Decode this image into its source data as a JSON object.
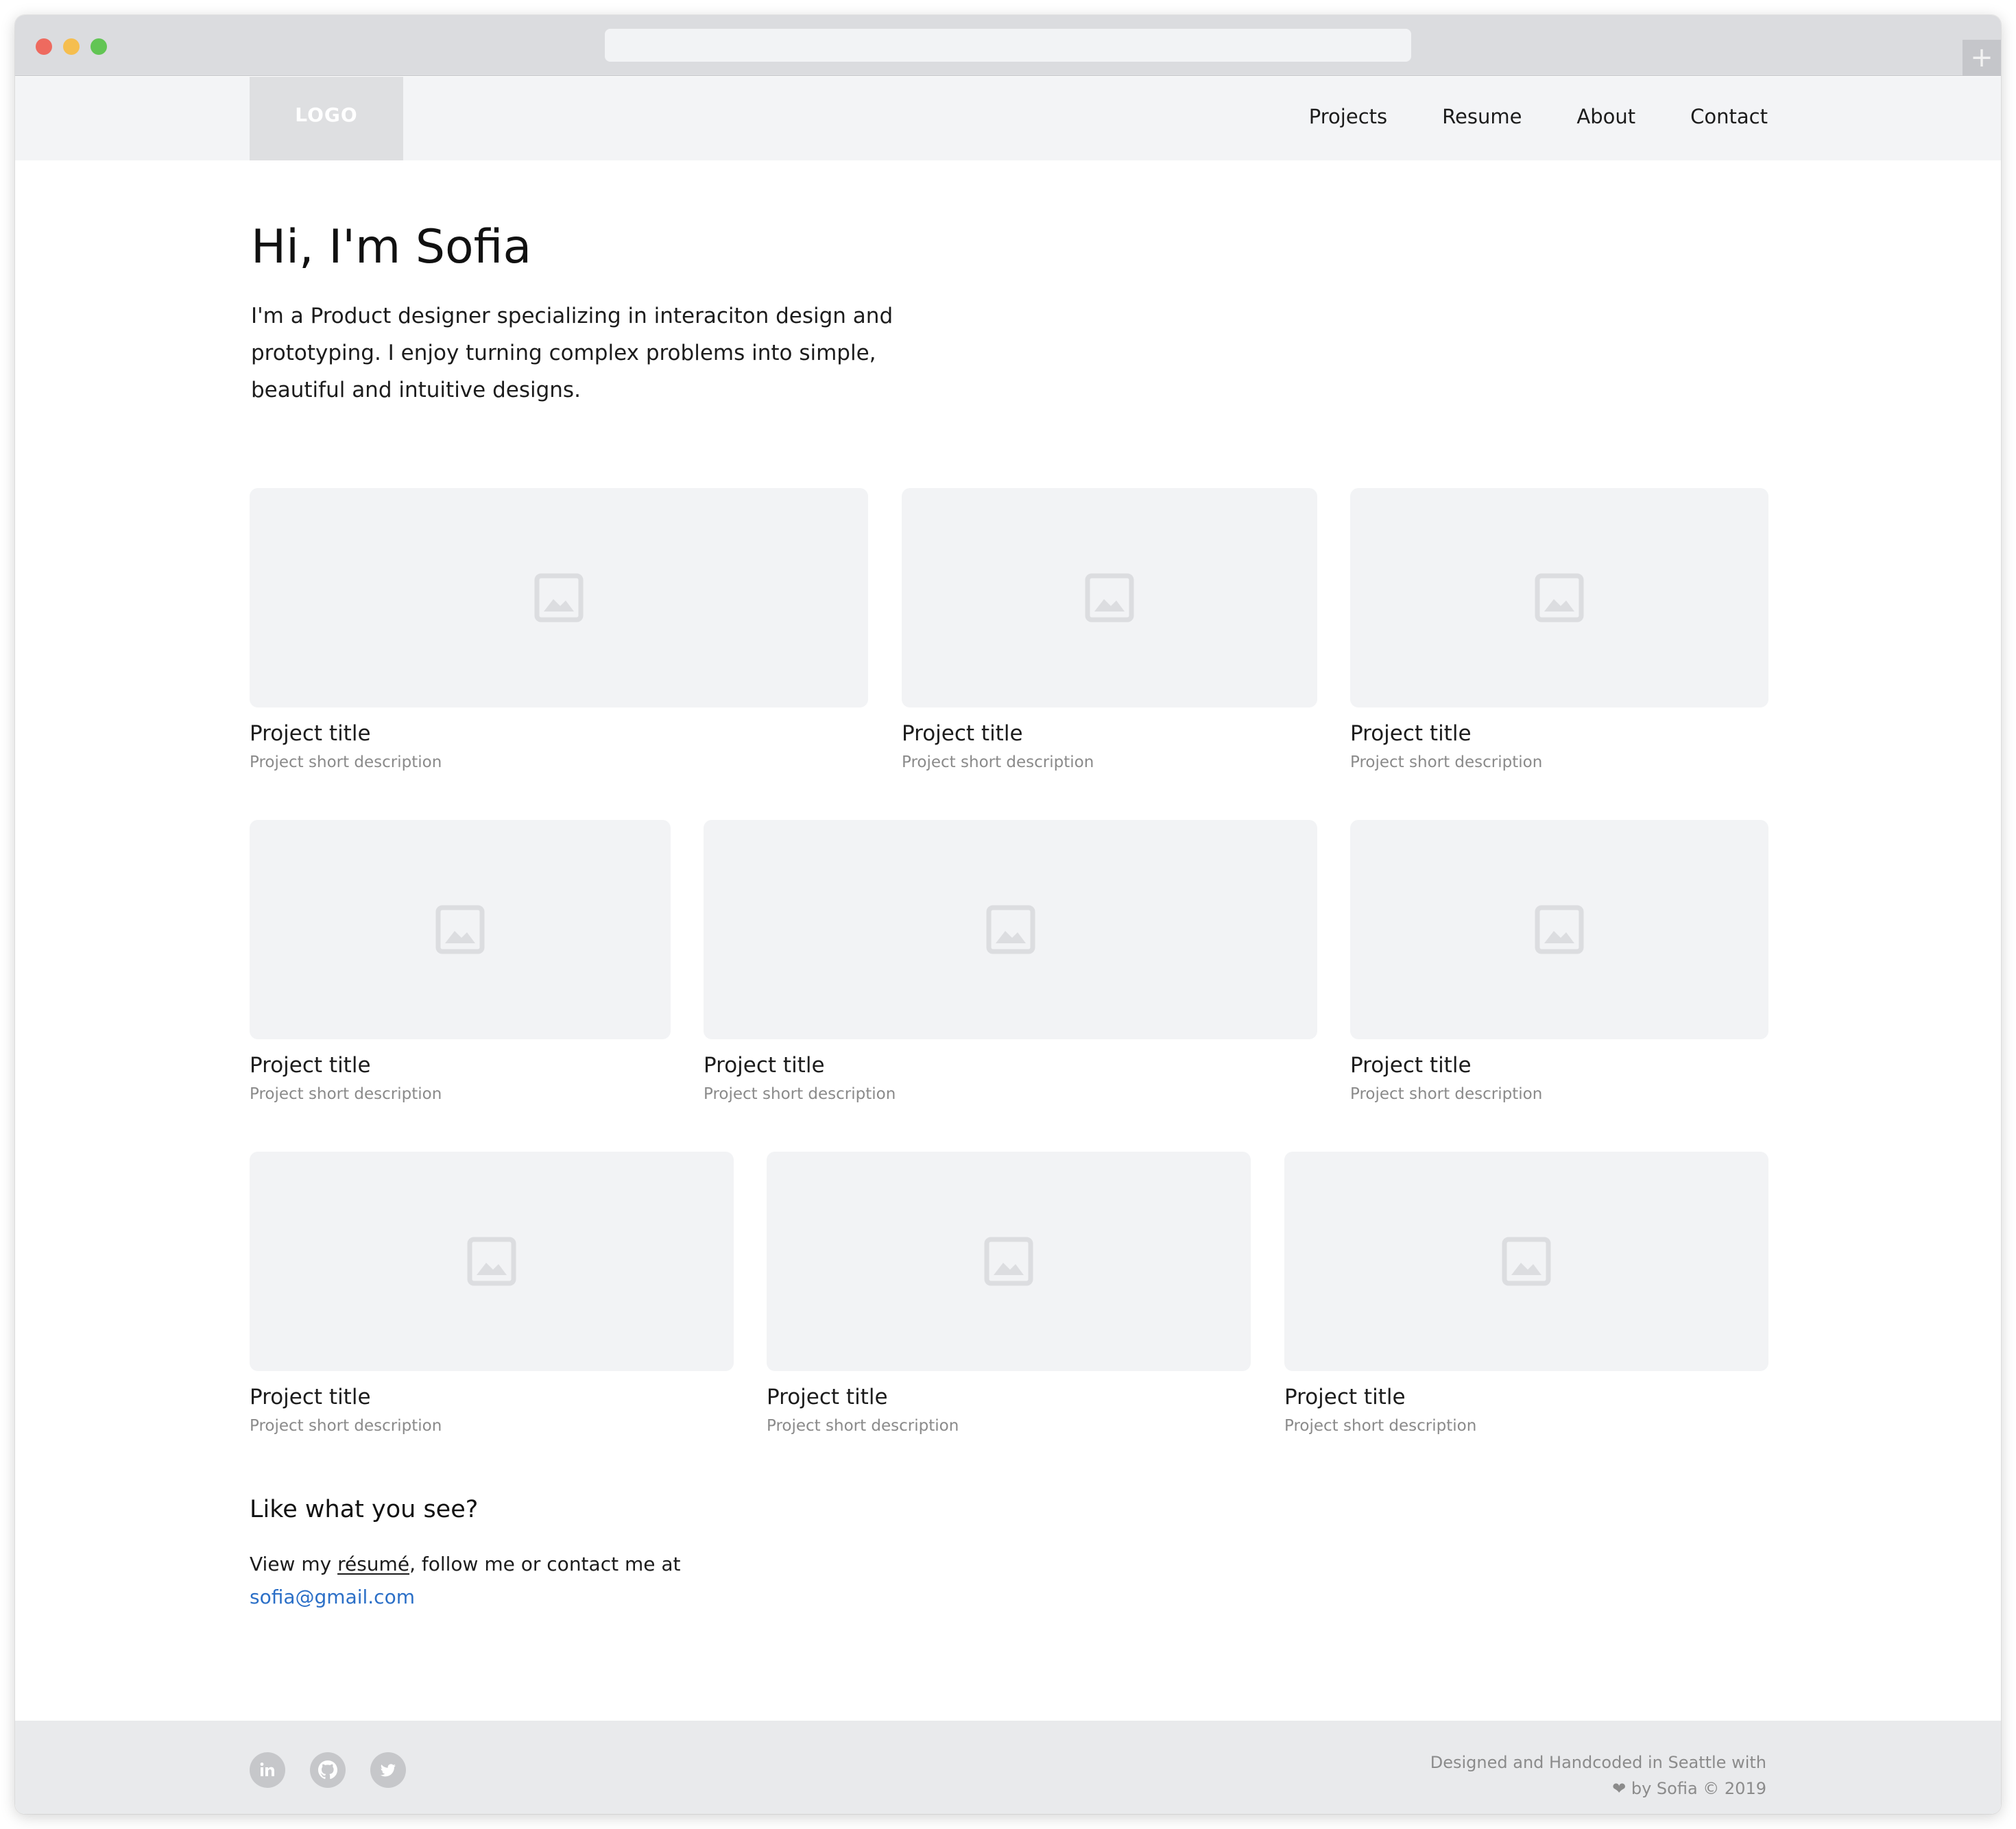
{
  "browser": {
    "url": "",
    "new_tab_label": "+"
  },
  "header": {
    "logo_text": "LOGO",
    "nav": [
      {
        "label": "Projects"
      },
      {
        "label": "Resume"
      },
      {
        "label": "About"
      },
      {
        "label": "Contact"
      }
    ]
  },
  "hero": {
    "title": "Hi, I'm Sofia",
    "text": "I'm a Product designer specializing in interaciton design and prototyping. I enjoy turning complex problems into simple, beautiful and intuitive designs."
  },
  "projects": [
    {
      "title": "Project title",
      "description": "Project short description",
      "thumb_icon": "image-placeholder-icon"
    },
    {
      "title": "Project title",
      "description": "Project short description",
      "thumb_icon": "image-placeholder-icon"
    },
    {
      "title": "Project title",
      "description": "Project short description",
      "thumb_icon": "image-placeholder-icon"
    },
    {
      "title": "Project title",
      "description": "Project short description",
      "thumb_icon": "image-placeholder-icon"
    },
    {
      "title": "Project title",
      "description": "Project short description",
      "thumb_icon": "image-placeholder-icon"
    },
    {
      "title": "Project title",
      "description": "Project short description",
      "thumb_icon": "image-placeholder-icon"
    },
    {
      "title": "Project title",
      "description": "Project short description",
      "thumb_icon": "image-placeholder-icon"
    },
    {
      "title": "Project title",
      "description": "Project short description",
      "thumb_icon": "image-placeholder-icon"
    },
    {
      "title": "Project title",
      "description": "Project short description",
      "thumb_icon": "image-placeholder-icon"
    }
  ],
  "cta": {
    "title": "Like what you see?",
    "text_prefix": "View my ",
    "resume_link": "résumé",
    "text_suffix": ", follow me or contact me at",
    "email": "sofia@gmail.com"
  },
  "footer": {
    "social": [
      {
        "icon": "linkedin-icon",
        "label": "in"
      },
      {
        "icon": "github-icon"
      },
      {
        "icon": "twitter-icon"
      }
    ],
    "credit_line1": "Designed and Handcoded in Seattle with",
    "heart_glyph": "❤",
    "credit_line2": " by Sofia © 2019"
  },
  "colors": {
    "header_bg": "#f3f4f6",
    "logo_bg": "#dedfe1",
    "thumb_bg": "#f2f3f5",
    "link": "#2b6fc7",
    "footer_bg": "#e9eaec",
    "muted_text": "#8a8a8a"
  }
}
